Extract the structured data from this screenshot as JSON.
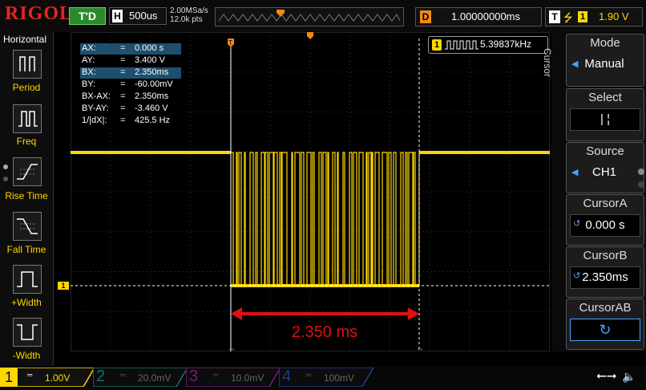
{
  "top": {
    "brand": "RIGOL",
    "trigger_status": "T'D",
    "timebase_key": "H",
    "timebase": "500us",
    "sample_rate": "2.00MSa/s",
    "memory_depth": "12.0k pts",
    "delay_key": "D",
    "delay": "1.00000000ms",
    "trigger_key": "T",
    "trigger_channel": "1",
    "trigger_level": "1.90 V"
  },
  "left_panel": {
    "title": "Horizontal",
    "items": [
      {
        "label": "Period",
        "icon": "period-icon"
      },
      {
        "label": "Freq",
        "icon": "freq-icon"
      },
      {
        "label": "Rise Time",
        "icon": "rise-time-icon"
      },
      {
        "label": "Fall Time",
        "icon": "fall-time-icon"
      },
      {
        "label": "+Width",
        "icon": "pos-width-icon"
      },
      {
        "label": "-Width",
        "icon": "neg-width-icon"
      }
    ]
  },
  "cursor_readout": [
    {
      "name": "AX:",
      "eq": "=",
      "value": "0.000 s",
      "highlight": true
    },
    {
      "name": "AY:",
      "eq": "=",
      "value": "3.400 V",
      "highlight": false
    },
    {
      "name": "BX:",
      "eq": "=",
      "value": "2.350ms",
      "highlight": true
    },
    {
      "name": "BY:",
      "eq": "=",
      "value": "-60.00mV",
      "highlight": false
    },
    {
      "name": "BX-AX:",
      "eq": "=",
      "value": "2.350ms",
      "highlight": false
    },
    {
      "name": "BY-AY:",
      "eq": "=",
      "value": "-3.460 V",
      "highlight": false
    },
    {
      "name": "1/|dX|:",
      "eq": "=",
      "value": "425.5 Hz",
      "highlight": false
    }
  ],
  "freq_counter": {
    "channel": "1",
    "value": "5.39837kHz"
  },
  "annotation": "2.350 ms",
  "right_menu": {
    "title": "Cursor",
    "mode_label": "Mode",
    "mode_value": "Manual",
    "select_label": "Select",
    "select_value": "|  ¦",
    "source_label": "Source",
    "source_value": "CH1",
    "cursora_label": "CursorA",
    "cursora_value": "0.000 s",
    "cursorb_label": "CursorB",
    "cursorb_value": "2.350ms",
    "cursorab_label": "CursorAB"
  },
  "channels": [
    {
      "num": "1",
      "scale": "1.00V",
      "color": "#ffd700"
    },
    {
      "num": "2",
      "scale": "20.0mV",
      "color": "#1ec8c8"
    },
    {
      "num": "3",
      "scale": "10.0mV",
      "color": "#d030d0"
    },
    {
      "num": "4",
      "scale": "100mV",
      "color": "#3c64ff"
    }
  ],
  "colors": {
    "ch1": "#ffd700",
    "accent": "#e4261d",
    "cursor": "#ffffff"
  }
}
